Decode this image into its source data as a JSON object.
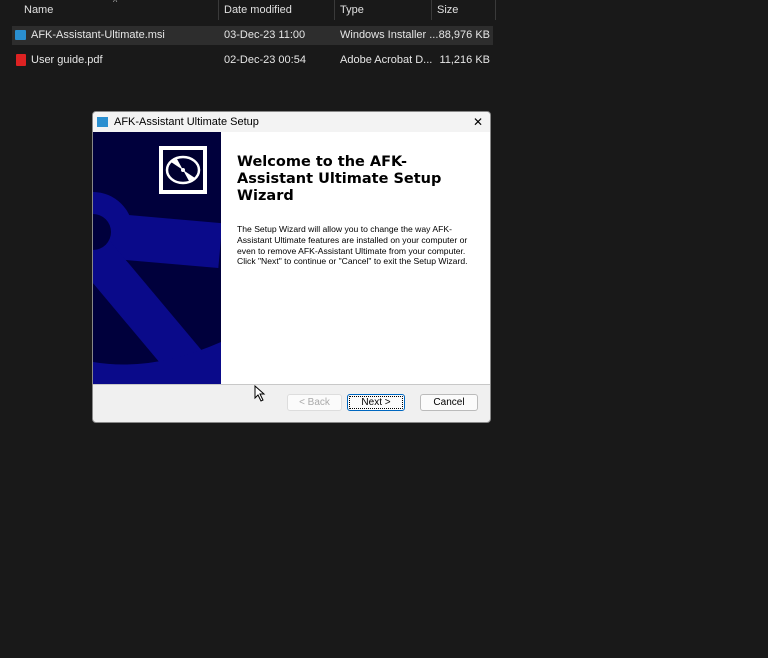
{
  "explorer": {
    "columns": [
      "Name",
      "Date modified",
      "Type",
      "Size"
    ],
    "files": [
      {
        "name": "AFK-Assistant-Ultimate.msi",
        "date": "03-Dec-23 11:00",
        "type": "Windows Installer ...",
        "size": "88,976 KB",
        "icon": "msi-installer-icon"
      },
      {
        "name": "User guide.pdf",
        "date": "02-Dec-23 00:54",
        "type": "Adobe Acrobat D...",
        "size": "11,216 KB",
        "icon": "pdf-icon"
      }
    ]
  },
  "dialog": {
    "title": "AFK-Assistant Ultimate Setup",
    "heading": "Welcome to the AFK-Assistant Ultimate Setup Wizard",
    "body": "The Setup Wizard will allow you to change the way AFK-Assistant Ultimate features are installed on your computer or even to remove AFK-Assistant Ultimate from your computer.  Click \"Next\" to continue or \"Cancel\" to exit the Setup Wizard.",
    "back": "< Back",
    "next": "Next >",
    "cancel": "Cancel",
    "close": "✕"
  }
}
